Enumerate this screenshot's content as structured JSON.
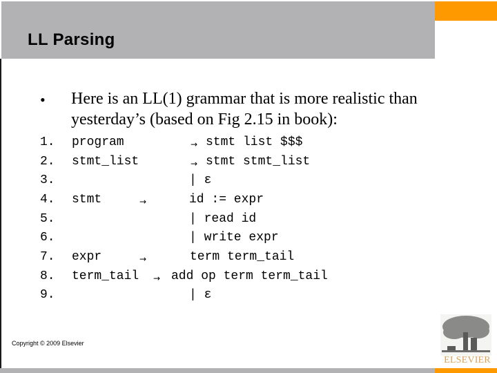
{
  "slide": {
    "title": "LL Parsing",
    "bullet_glyph": "•",
    "intro_text": "Here is an LL(1) grammar that is more realistic than yesterday’s (based on Fig 2.15 in book):",
    "arrow_glyph": "→",
    "grammar": [
      {
        "num": "1.",
        "lhs": "program",
        "arrow": "→",
        "rhs": "stmt list $$$"
      },
      {
        "num": "2.",
        "lhs": "stmt_list",
        "arrow": "→",
        "rhs": "stmt stmt_list"
      },
      {
        "num": "3.",
        "lhs": "",
        "arrow": "",
        "rhs": "| ε"
      },
      {
        "num": "4.",
        "lhs": "stmt",
        "arrow": "→",
        "rhs": "id := expr"
      },
      {
        "num": "5.",
        "lhs": "",
        "arrow": "",
        "rhs": "| read id"
      },
      {
        "num": "6.",
        "lhs": "",
        "arrow": "",
        "rhs": "| write expr"
      },
      {
        "num": "7.",
        "lhs": "expr",
        "arrow": "→",
        "rhs": "term term_tail"
      },
      {
        "num": "8.",
        "lhs": "term_tail",
        "arrow": "→",
        "rhs": "add op term term_tail"
      },
      {
        "num": "9.",
        "lhs": "",
        "arrow": "",
        "rhs": "| ε"
      }
    ],
    "copyright": "Copyright © 2009 Elsevier",
    "logo_text": "ELSEVIER"
  },
  "colors": {
    "header_gray": "#b2b2b4",
    "accent_orange": "#ff9900",
    "logo_tan": "#d9a25a"
  }
}
